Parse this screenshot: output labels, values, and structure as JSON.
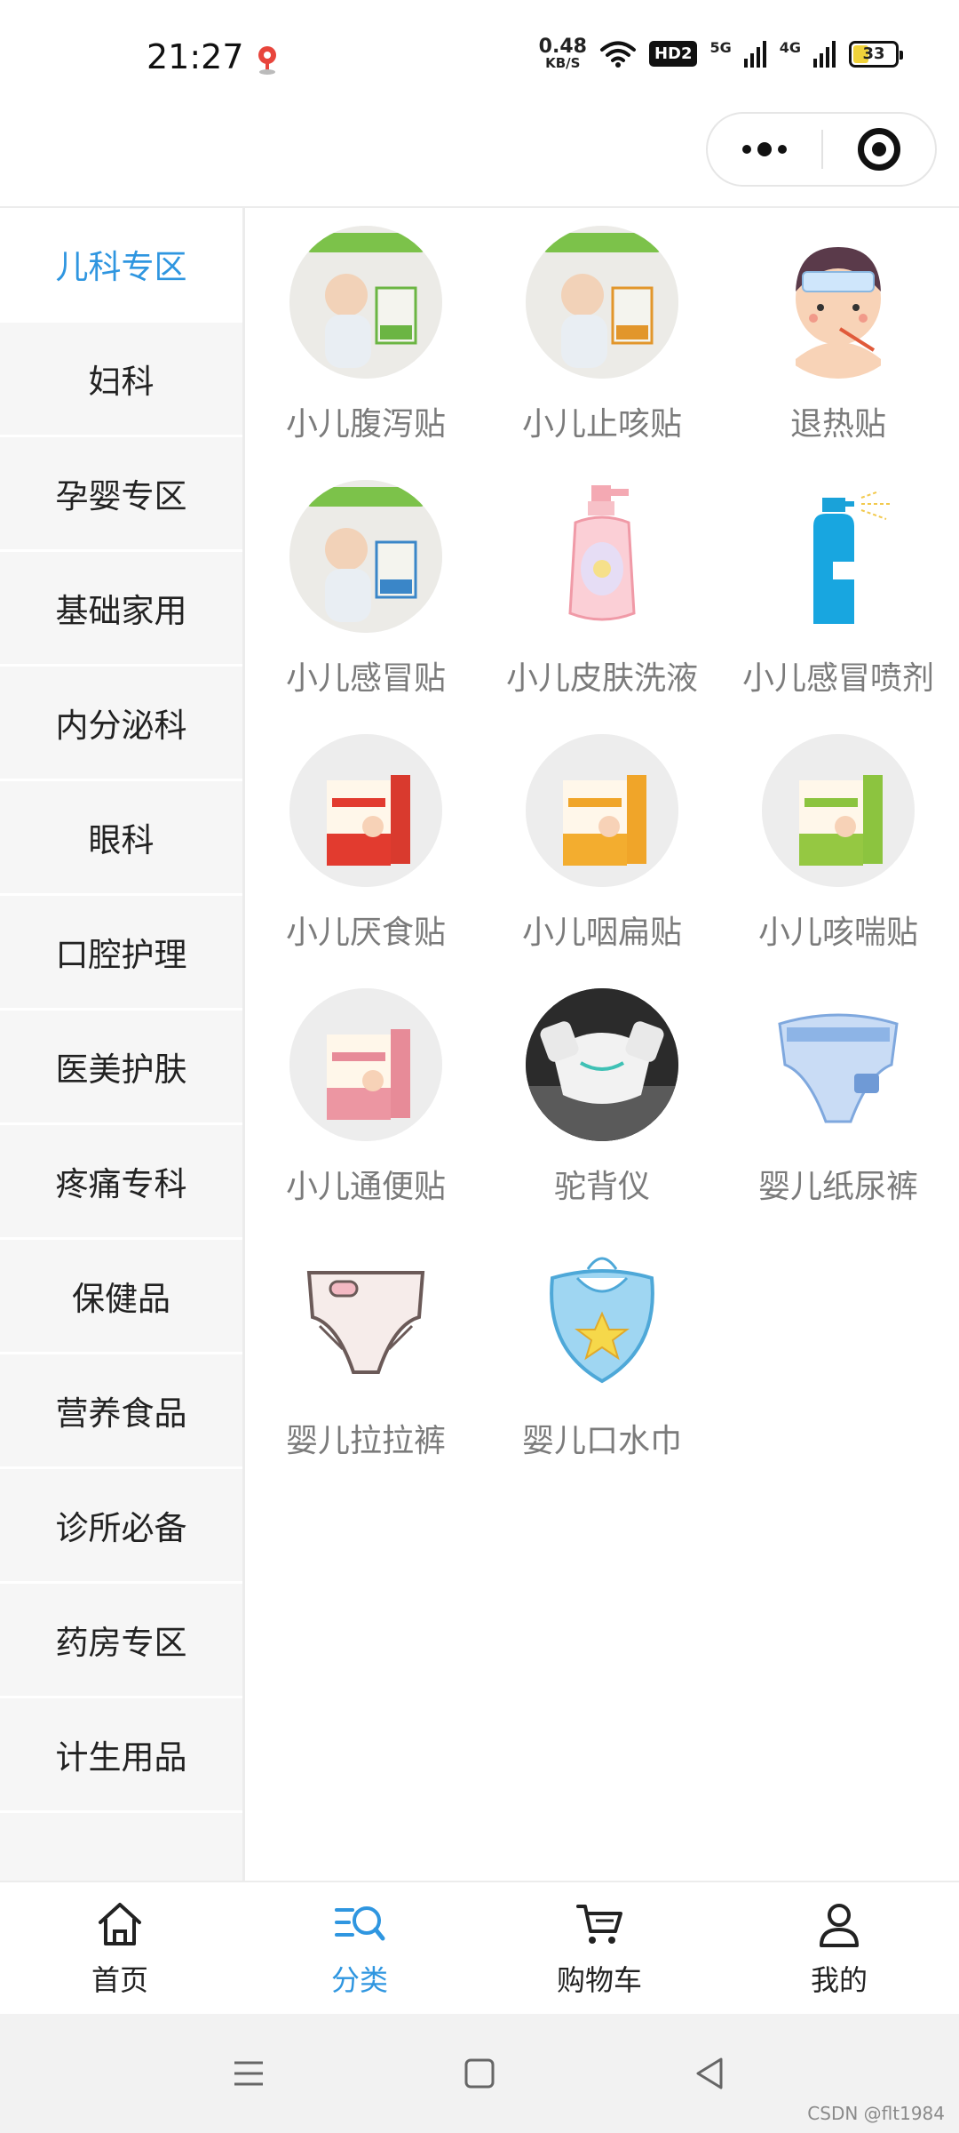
{
  "status_bar": {
    "time": "21:27",
    "net_speed_value": "0.48",
    "net_speed_unit": "KB/S",
    "hd_label": "HD2",
    "signal_5g": "5G",
    "signal_4g": "4G",
    "battery": "33"
  },
  "sidebar": {
    "items": [
      {
        "label": "儿科专区",
        "active": true
      },
      {
        "label": "妇科"
      },
      {
        "label": "孕婴专区"
      },
      {
        "label": "基础家用"
      },
      {
        "label": "内分泌科"
      },
      {
        "label": "眼科"
      },
      {
        "label": "口腔护理"
      },
      {
        "label": "医美护肤"
      },
      {
        "label": "疼痛专科"
      },
      {
        "label": "保健品"
      },
      {
        "label": "营养食品"
      },
      {
        "label": "诊所必备"
      },
      {
        "label": "药房专区"
      },
      {
        "label": "计生用品"
      }
    ]
  },
  "products": [
    {
      "label": "小儿腹泻贴",
      "icon": "baby-box-photo-green"
    },
    {
      "label": "小儿止咳贴",
      "icon": "baby-box-photo-orange"
    },
    {
      "label": "退热贴",
      "icon": "fever-boy-icon"
    },
    {
      "label": "小儿感冒贴",
      "icon": "baby-box-photo-blue"
    },
    {
      "label": "小儿皮肤洗液",
      "icon": "lotion-bottle-icon"
    },
    {
      "label": "小儿感冒喷剂",
      "icon": "spray-bottle-icon"
    },
    {
      "label": "小儿厌食贴",
      "icon": "red-box-icon"
    },
    {
      "label": "小儿咽扁贴",
      "icon": "orange-box-icon"
    },
    {
      "label": "小儿咳喘贴",
      "icon": "green-box-icon"
    },
    {
      "label": "小儿通便贴",
      "icon": "pink-box-icon"
    },
    {
      "label": "驼背仪",
      "icon": "posture-device-photo"
    },
    {
      "label": "婴儿纸尿裤",
      "icon": "blue-diaper-icon"
    },
    {
      "label": "婴儿拉拉裤",
      "icon": "pull-up-diaper-icon"
    },
    {
      "label": "婴儿口水巾",
      "icon": "bib-icon"
    }
  ],
  "tabbar": {
    "tabs": [
      {
        "label": "首页",
        "icon": "home-icon"
      },
      {
        "label": "分类",
        "icon": "category-search-icon",
        "active": true
      },
      {
        "label": "购物车",
        "icon": "cart-icon"
      },
      {
        "label": "我的",
        "icon": "user-icon"
      }
    ]
  },
  "watermark": "CSDN @flt1984",
  "colors": {
    "accent": "#2f96e0",
    "sidebar_bg": "#f6f6f6",
    "label_gray": "#7b7b7b"
  }
}
